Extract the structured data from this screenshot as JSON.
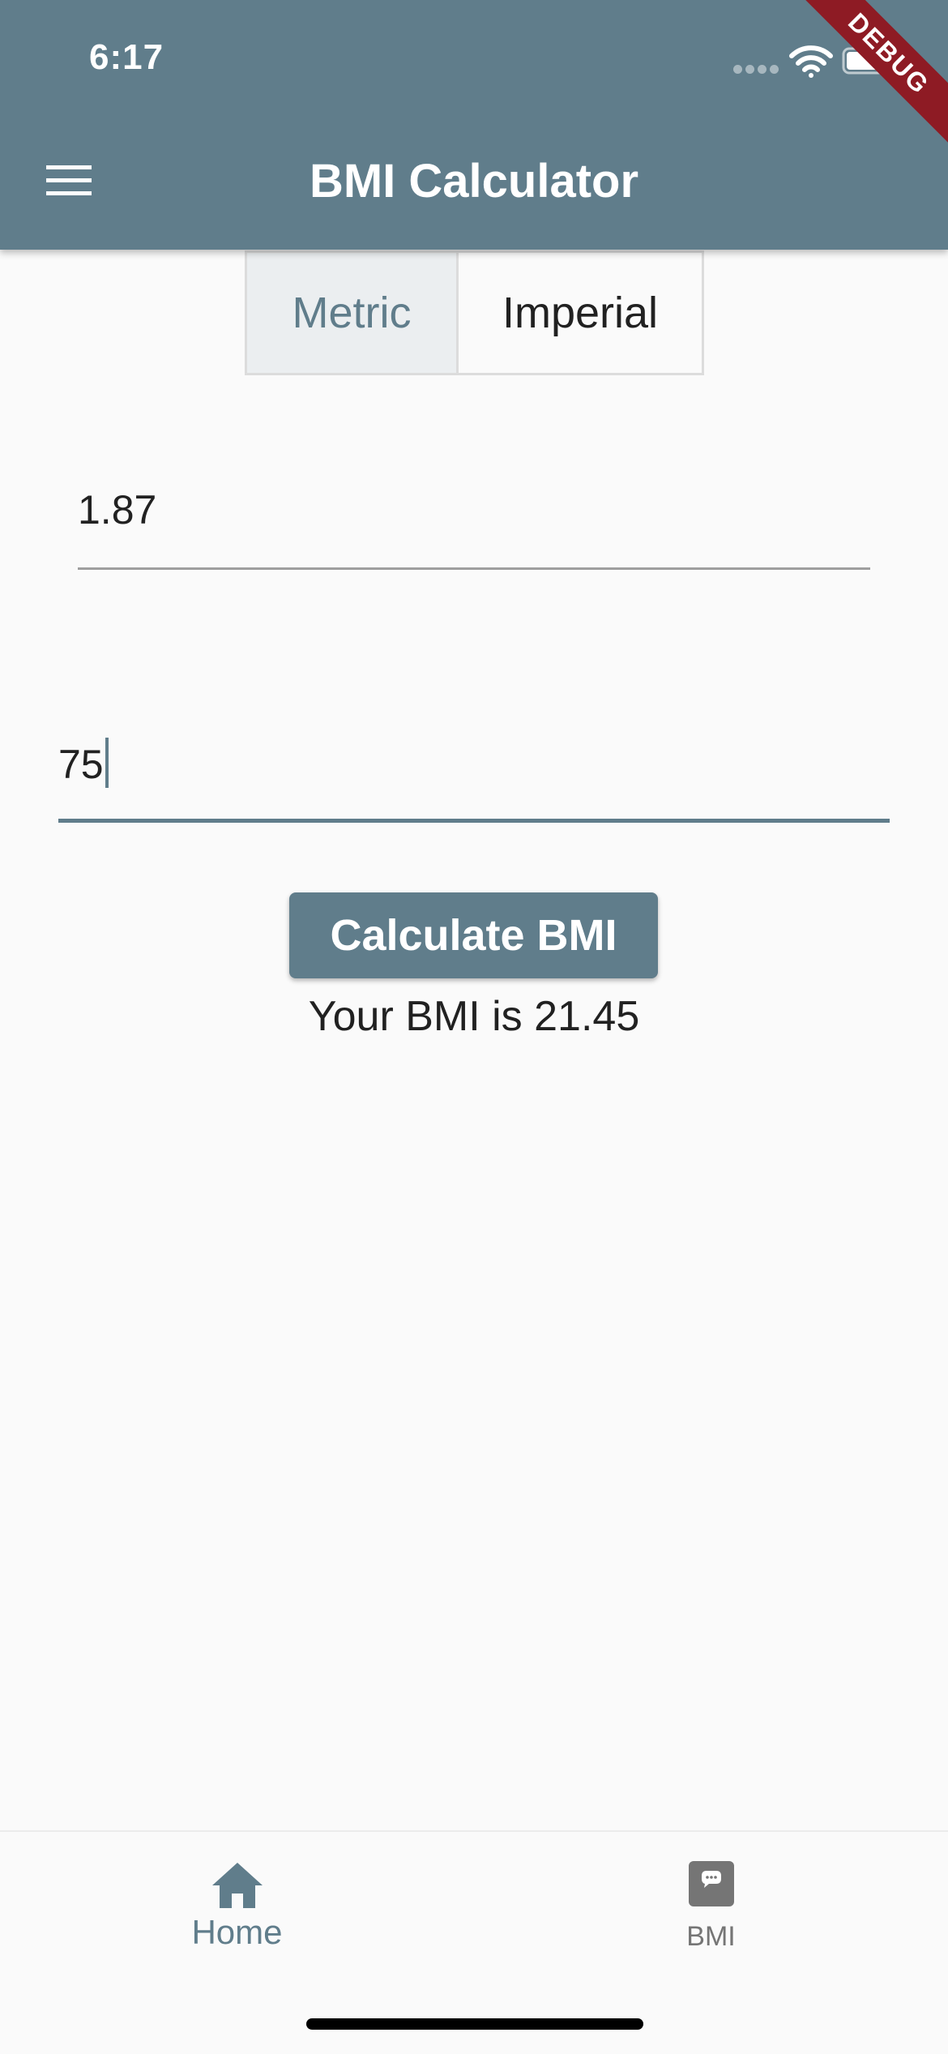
{
  "status_bar": {
    "time": "6:17",
    "icons": [
      "signal-dots-icon",
      "wifi-icon",
      "battery-icon"
    ]
  },
  "debug_banner": "DEBUG",
  "app_bar": {
    "title": "BMI Calculator",
    "menu_icon": "hamburger-menu-icon",
    "color": "#607d8b"
  },
  "unit_toggle": {
    "options": [
      "Metric",
      "Imperial"
    ],
    "selected": "Metric"
  },
  "inputs": {
    "height_value": "1.87",
    "weight_value": "75"
  },
  "calculate_button": "Calculate BMI",
  "result": "Your BMI is 21.45",
  "bottom_nav": {
    "items": [
      {
        "label": "Home",
        "icon": "home-icon",
        "selected": true
      },
      {
        "label": "BMI",
        "icon": "chat-bubble-icon",
        "selected": false
      }
    ],
    "selected_color": "#607d8b",
    "unselected_color": "#757575"
  }
}
